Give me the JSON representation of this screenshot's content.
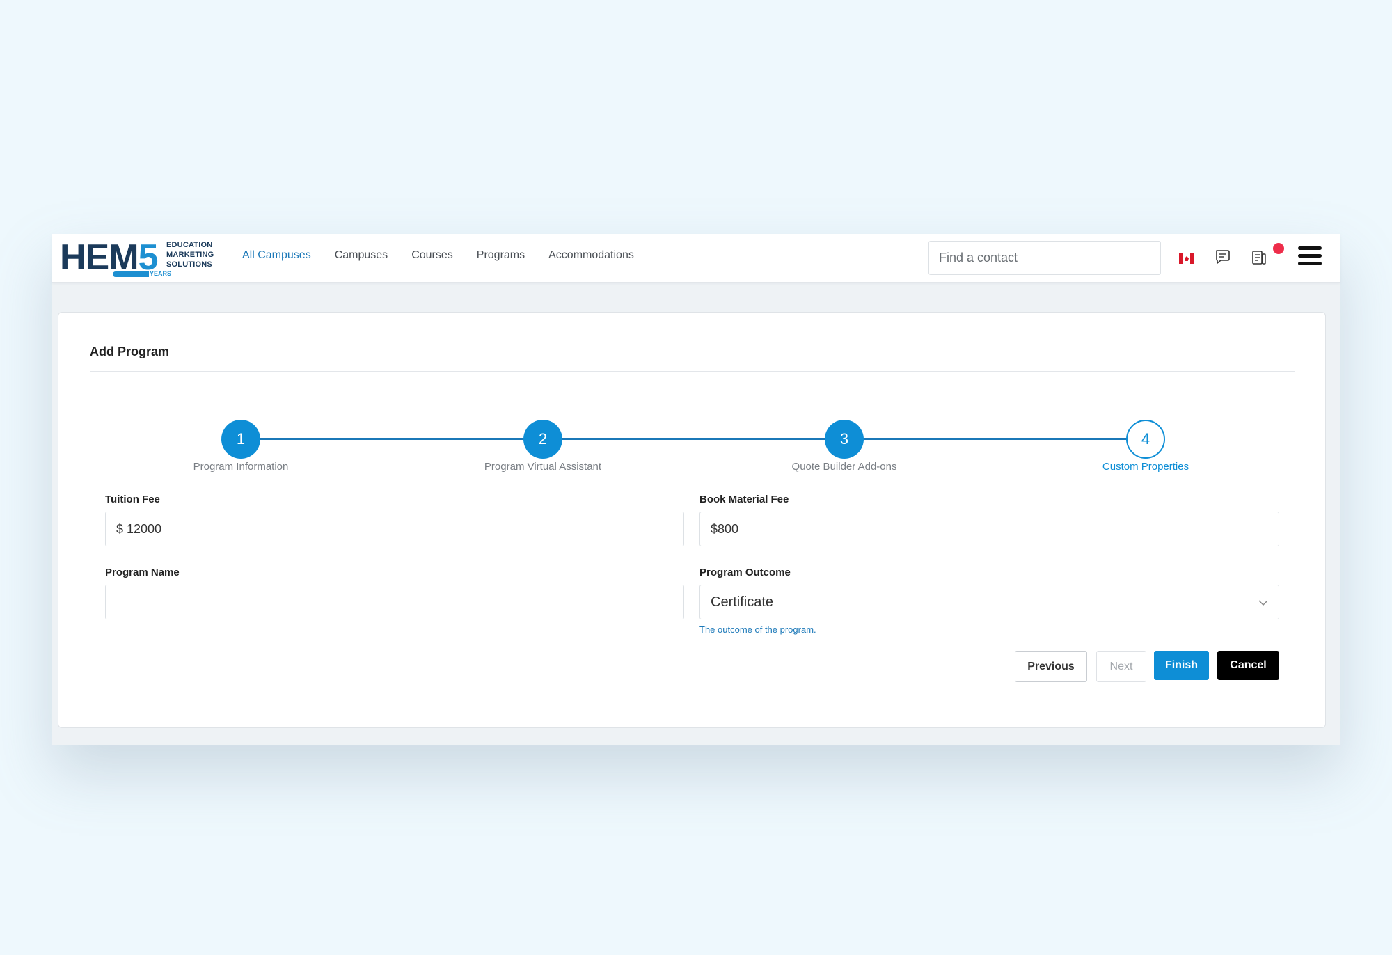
{
  "logo": {
    "hem": "HEM",
    "five": "5",
    "line1": "EDUCATION",
    "line2": "MARKETING",
    "line3": "SOLUTIONS",
    "years": "YEARS"
  },
  "nav": {
    "items": [
      {
        "label": "All Campuses",
        "active": true
      },
      {
        "label": "Campuses"
      },
      {
        "label": "Courses"
      },
      {
        "label": "Programs"
      },
      {
        "label": "Accommodations"
      }
    ]
  },
  "search": {
    "placeholder": "Find a contact",
    "value": ""
  },
  "header_icons": [
    "flag-canada-icon",
    "chat-icon",
    "document-icon",
    "menu-icon"
  ],
  "colors": {
    "accent": "#0e8ed6",
    "nav_active": "#1b78b8",
    "notification": "#ee2d4a",
    "cancel": "#000000"
  },
  "page": {
    "title": "Add Program"
  },
  "stepper": {
    "steps": [
      {
        "number": "1",
        "label": "Program Information",
        "status": "complete"
      },
      {
        "number": "2",
        "label": "Program Virtual Assistant",
        "status": "complete"
      },
      {
        "number": "3",
        "label": "Quote Builder Add-ons",
        "status": "complete"
      },
      {
        "number": "4",
        "label": "Custom Properties",
        "status": "current"
      }
    ]
  },
  "form": {
    "tuition_fee": {
      "label": "Tuition Fee",
      "value": "$ 12000"
    },
    "book_material_fee": {
      "label": "Book Material Fee",
      "value": "$800"
    },
    "program_name": {
      "label": "Program Name",
      "value": ""
    },
    "program_outcome": {
      "label": "Program Outcome",
      "value": "Certificate",
      "help": "The outcome of the program."
    }
  },
  "actions": {
    "previous": "Previous",
    "next": "Next",
    "finish": "Finish",
    "cancel": "Cancel"
  }
}
